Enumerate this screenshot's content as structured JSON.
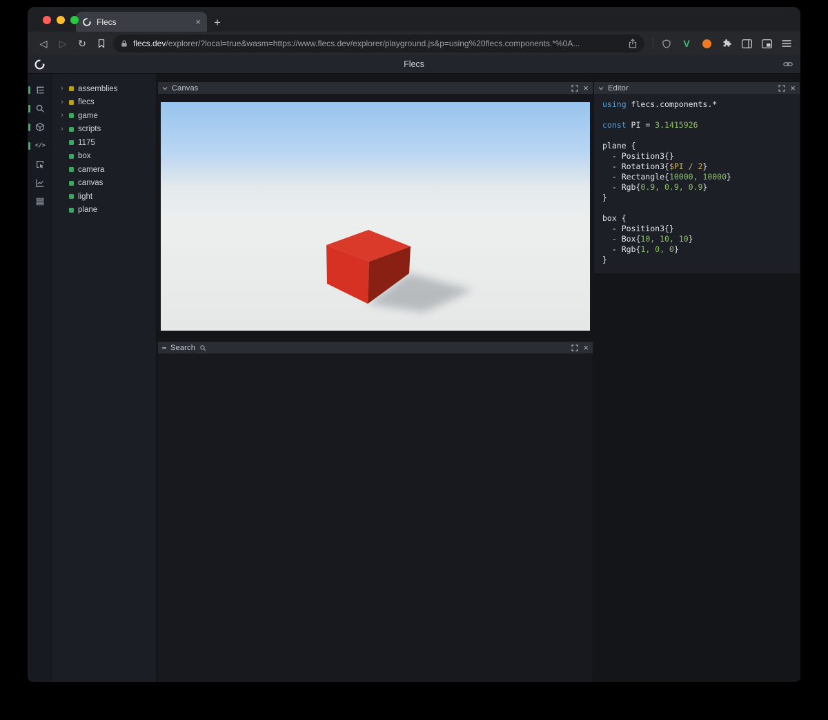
{
  "glyphs": {
    "back": "◁",
    "forward": "▷",
    "reload": "↻",
    "close": "×",
    "new_tab": "+",
    "chevron_right": "›",
    "code": "</>"
  },
  "browser": {
    "tab_title": "Flecs",
    "url_host": "flecs.dev",
    "url_path": "/explorer/?local=true&wasm=https://www.flecs.dev/explorer/playground.js&p=using%20flecs.components.*%0A..."
  },
  "header": {
    "title": "Flecs"
  },
  "rail": {
    "items": [
      {
        "name": "tree-icon",
        "active": true
      },
      {
        "name": "search-icon",
        "active": true
      },
      {
        "name": "cube-icon",
        "active": true
      },
      {
        "name": "code-icon",
        "active": true
      },
      {
        "name": "inspect-icon",
        "active": false
      },
      {
        "name": "chart-icon",
        "active": false
      },
      {
        "name": "rows-icon",
        "active": false
      }
    ]
  },
  "tree": {
    "items": [
      {
        "label": "assemblies",
        "color": "#bfa100",
        "expandable": true
      },
      {
        "label": "flecs",
        "color": "#bfa100",
        "expandable": true
      },
      {
        "label": "game",
        "color": "#3fa662",
        "expandable": true
      },
      {
        "label": "scripts",
        "color": "#3fa662",
        "expandable": true
      },
      {
        "label": "1175",
        "color": "#3fa662",
        "expandable": false
      },
      {
        "label": "box",
        "color": "#3fa662",
        "expandable": false
      },
      {
        "label": "camera",
        "color": "#3fa662",
        "expandable": false
      },
      {
        "label": "canvas",
        "color": "#3fa662",
        "expandable": false
      },
      {
        "label": "light",
        "color": "#3fa662",
        "expandable": false
      },
      {
        "label": "plane",
        "color": "#3fa662",
        "expandable": false
      }
    ]
  },
  "panels": {
    "canvas": {
      "title": "Canvas"
    },
    "search": {
      "title": "Search"
    },
    "editor": {
      "title": "Editor"
    }
  },
  "scene": {
    "sky_top": "#98c4ee",
    "sky_bottom": "#b9d6f2",
    "horizon": "#e3e9ec",
    "ground": "#edefee",
    "ground_dim": "#e5e8e7",
    "box_top": "#da3a2a",
    "box_front": "#d63123",
    "box_side": "#8a2014",
    "shadow": "#7b8289"
  },
  "code": {
    "lines": [
      [
        {
          "t": "using",
          "c": "kw"
        },
        {
          "t": " flecs.components.*",
          "c": "pl"
        }
      ],
      [],
      [
        {
          "t": "const",
          "c": "kw"
        },
        {
          "t": " PI = ",
          "c": "pl"
        },
        {
          "t": "3.1415926",
          "c": "num"
        }
      ],
      [],
      [
        {
          "t": "plane {",
          "c": "pl"
        }
      ],
      [
        {
          "t": "  - Position3{}",
          "c": "pl"
        }
      ],
      [
        {
          "t": "  - Rotation3{",
          "c": "pl"
        },
        {
          "t": "$PI / 2",
          "c": "var"
        },
        {
          "t": "}",
          "c": "pl"
        }
      ],
      [
        {
          "t": "  - Rectangle{",
          "c": "pl"
        },
        {
          "t": "10000, 10000",
          "c": "num"
        },
        {
          "t": "}",
          "c": "pl"
        }
      ],
      [
        {
          "t": "  - Rgb{",
          "c": "pl"
        },
        {
          "t": "0.9, 0.9, 0.9",
          "c": "num"
        },
        {
          "t": "}",
          "c": "pl"
        }
      ],
      [
        {
          "t": "}",
          "c": "pl"
        }
      ],
      [],
      [
        {
          "t": "box {",
          "c": "pl"
        }
      ],
      [
        {
          "t": "  - Position3{}",
          "c": "pl"
        }
      ],
      [
        {
          "t": "  - Box{",
          "c": "pl"
        },
        {
          "t": "10, 10, 10",
          "c": "num"
        },
        {
          "t": "}",
          "c": "pl"
        }
      ],
      [
        {
          "t": "  - Rgb{",
          "c": "pl"
        },
        {
          "t": "1, 0, 0",
          "c": "num"
        },
        {
          "t": "}",
          "c": "pl"
        }
      ],
      [
        {
          "t": "}",
          "c": "pl"
        }
      ]
    ]
  }
}
